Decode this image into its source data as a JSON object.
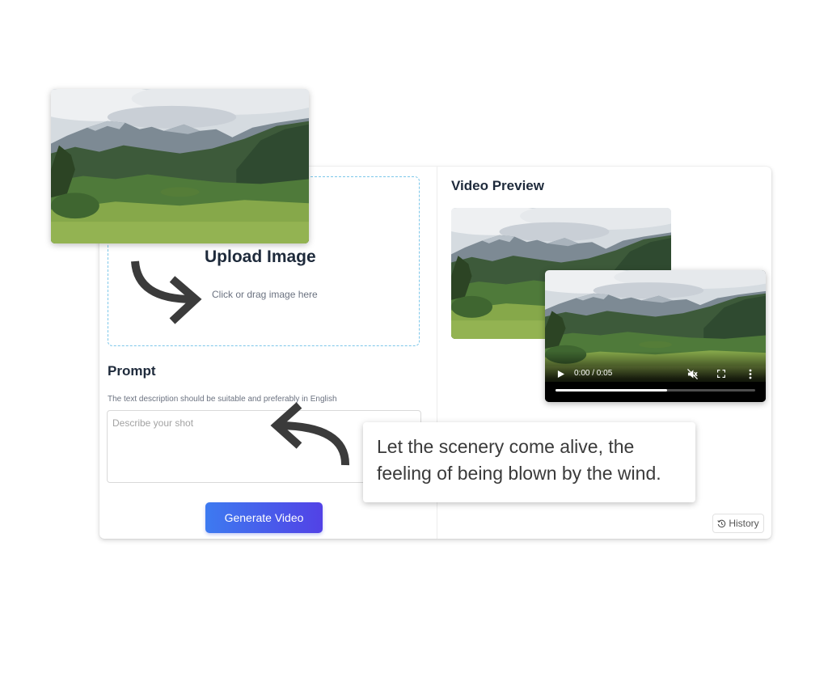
{
  "upload": {
    "title": "Upload Image",
    "hint": "Click or drag image here"
  },
  "prompt": {
    "title": "Prompt",
    "description": "The text description should be suitable and preferably in English",
    "placeholder": "Describe your shot",
    "value": ""
  },
  "generate_button": "Generate Video",
  "preview": {
    "title": "Video Preview"
  },
  "video": {
    "time": "0:00 / 0:05",
    "progress": 0.56,
    "muted": true
  },
  "history_button": "History",
  "callout": "Let the scenery come alive, the feeling of being blown by the wind.",
  "icons": {
    "play": "play-icon",
    "mute": "volume-muted-icon",
    "fullscreen": "fullscreen-icon",
    "more": "more-vertical-icon",
    "history": "history-icon",
    "arrow_down_right": "curved-arrow-icon",
    "arrow_back": "curved-arrow-back-icon"
  },
  "colors": {
    "accent_start": "#3d7af0",
    "accent_end": "#5242e6",
    "upload_border": "#7cc7ea",
    "heading": "#1e2a3b"
  }
}
